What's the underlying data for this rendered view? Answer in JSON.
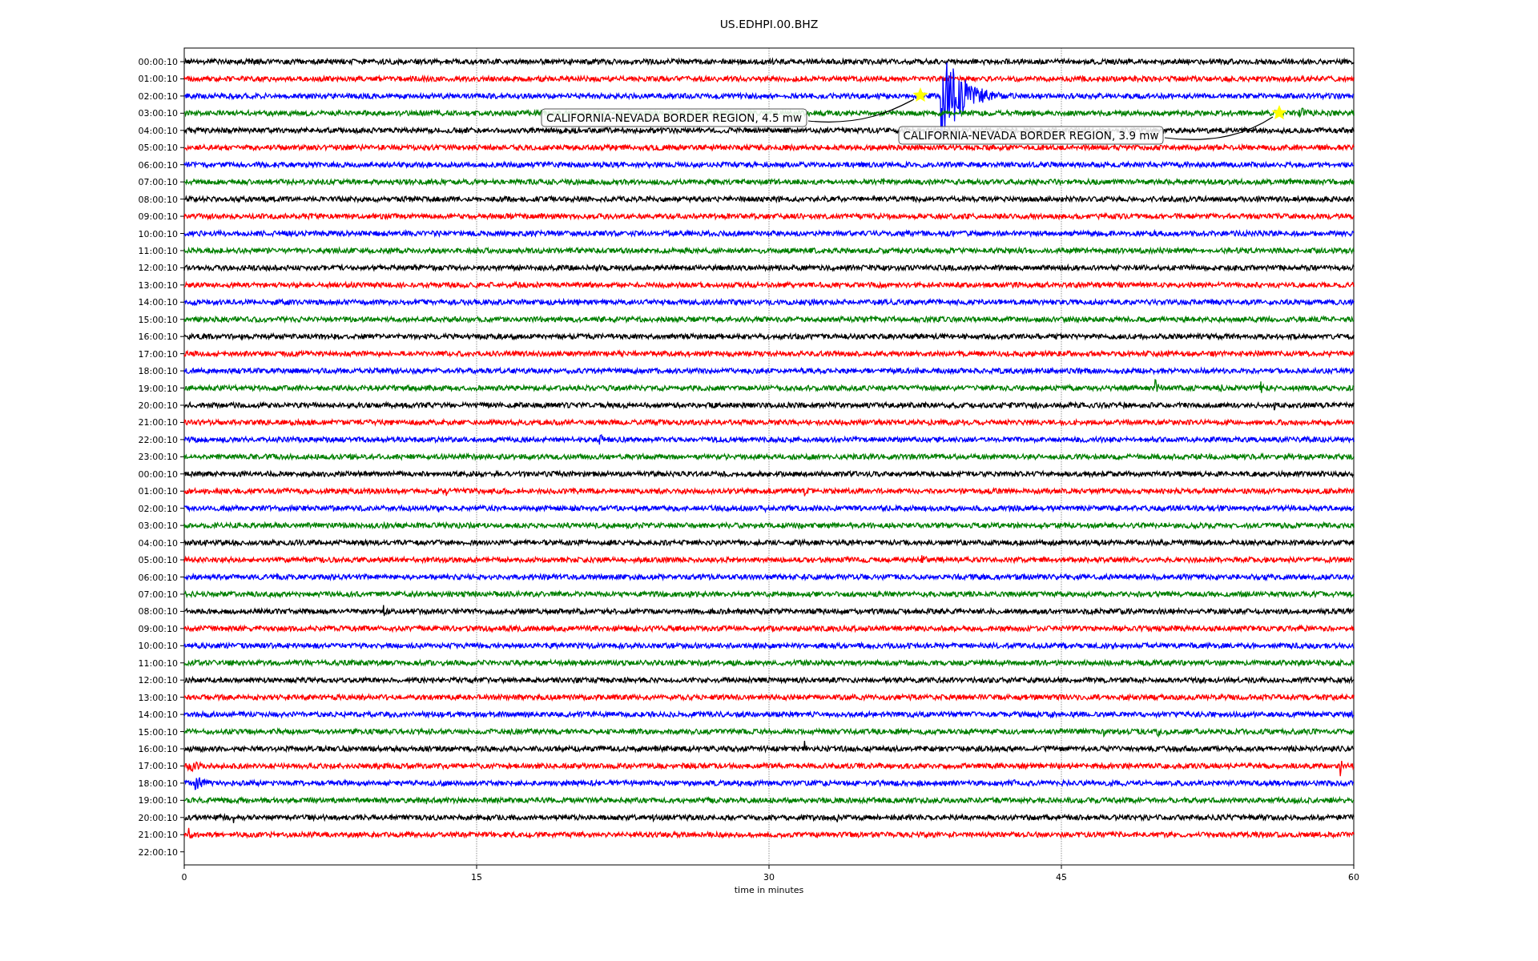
{
  "plot": {
    "title": "US.EDHPI.00.BHZ",
    "xlabel": "time in minutes",
    "xticks": [
      "0",
      "15",
      "30",
      "45",
      "60"
    ],
    "rows": [
      {
        "label": "00:00:10",
        "color": "#000000",
        "trace": true
      },
      {
        "label": "01:00:10",
        "color": "#ff0000",
        "trace": true
      },
      {
        "label": "02:00:10",
        "color": "#0000ff",
        "trace": true
      },
      {
        "label": "03:00:10",
        "color": "#008000",
        "trace": true
      },
      {
        "label": "04:00:10",
        "color": "#000000",
        "trace": true
      },
      {
        "label": "05:00:10",
        "color": "#ff0000",
        "trace": true
      },
      {
        "label": "06:00:10",
        "color": "#0000ff",
        "trace": true
      },
      {
        "label": "07:00:10",
        "color": "#008000",
        "trace": true
      },
      {
        "label": "08:00:10",
        "color": "#000000",
        "trace": true
      },
      {
        "label": "09:00:10",
        "color": "#ff0000",
        "trace": true
      },
      {
        "label": "10:00:10",
        "color": "#0000ff",
        "trace": true
      },
      {
        "label": "11:00:10",
        "color": "#008000",
        "trace": true
      },
      {
        "label": "12:00:10",
        "color": "#000000",
        "trace": true
      },
      {
        "label": "13:00:10",
        "color": "#ff0000",
        "trace": true
      },
      {
        "label": "14:00:10",
        "color": "#0000ff",
        "trace": true
      },
      {
        "label": "15:00:10",
        "color": "#008000",
        "trace": true
      },
      {
        "label": "16:00:10",
        "color": "#000000",
        "trace": true
      },
      {
        "label": "17:00:10",
        "color": "#ff0000",
        "trace": true
      },
      {
        "label": "18:00:10",
        "color": "#0000ff",
        "trace": true
      },
      {
        "label": "19:00:10",
        "color": "#008000",
        "trace": true
      },
      {
        "label": "20:00:10",
        "color": "#000000",
        "trace": true
      },
      {
        "label": "21:00:10",
        "color": "#ff0000",
        "trace": true
      },
      {
        "label": "22:00:10",
        "color": "#0000ff",
        "trace": true
      },
      {
        "label": "23:00:10",
        "color": "#008000",
        "trace": true
      },
      {
        "label": "00:00:10",
        "color": "#000000",
        "trace": true
      },
      {
        "label": "01:00:10",
        "color": "#ff0000",
        "trace": true
      },
      {
        "label": "02:00:10",
        "color": "#0000ff",
        "trace": true
      },
      {
        "label": "03:00:10",
        "color": "#008000",
        "trace": true
      },
      {
        "label": "04:00:10",
        "color": "#000000",
        "trace": true
      },
      {
        "label": "05:00:10",
        "color": "#ff0000",
        "trace": true
      },
      {
        "label": "06:00:10",
        "color": "#0000ff",
        "trace": true
      },
      {
        "label": "07:00:10",
        "color": "#008000",
        "trace": true
      },
      {
        "label": "08:00:10",
        "color": "#000000",
        "trace": true
      },
      {
        "label": "09:00:10",
        "color": "#ff0000",
        "trace": true
      },
      {
        "label": "10:00:10",
        "color": "#0000ff",
        "trace": true
      },
      {
        "label": "11:00:10",
        "color": "#008000",
        "trace": true
      },
      {
        "label": "12:00:10",
        "color": "#000000",
        "trace": true
      },
      {
        "label": "13:00:10",
        "color": "#ff0000",
        "trace": true
      },
      {
        "label": "14:00:10",
        "color": "#0000ff",
        "trace": true
      },
      {
        "label": "15:00:10",
        "color": "#008000",
        "trace": true
      },
      {
        "label": "16:00:10",
        "color": "#000000",
        "trace": true
      },
      {
        "label": "17:00:10",
        "color": "#ff0000",
        "trace": true
      },
      {
        "label": "18:00:10",
        "color": "#0000ff",
        "trace": true
      },
      {
        "label": "19:00:10",
        "color": "#008000",
        "trace": true
      },
      {
        "label": "20:00:10",
        "color": "#000000",
        "trace": true
      },
      {
        "label": "21:00:10",
        "color": "#ff0000",
        "trace": true
      },
      {
        "label": "22:00:10",
        "trace": false
      }
    ],
    "annotations": [
      "CALIFORNIA-NEVADA BORDER REGION, 4.5 mw",
      "CALIFORNIA-NEVADA BORDER REGION, 3.9 mw"
    ]
  }
}
